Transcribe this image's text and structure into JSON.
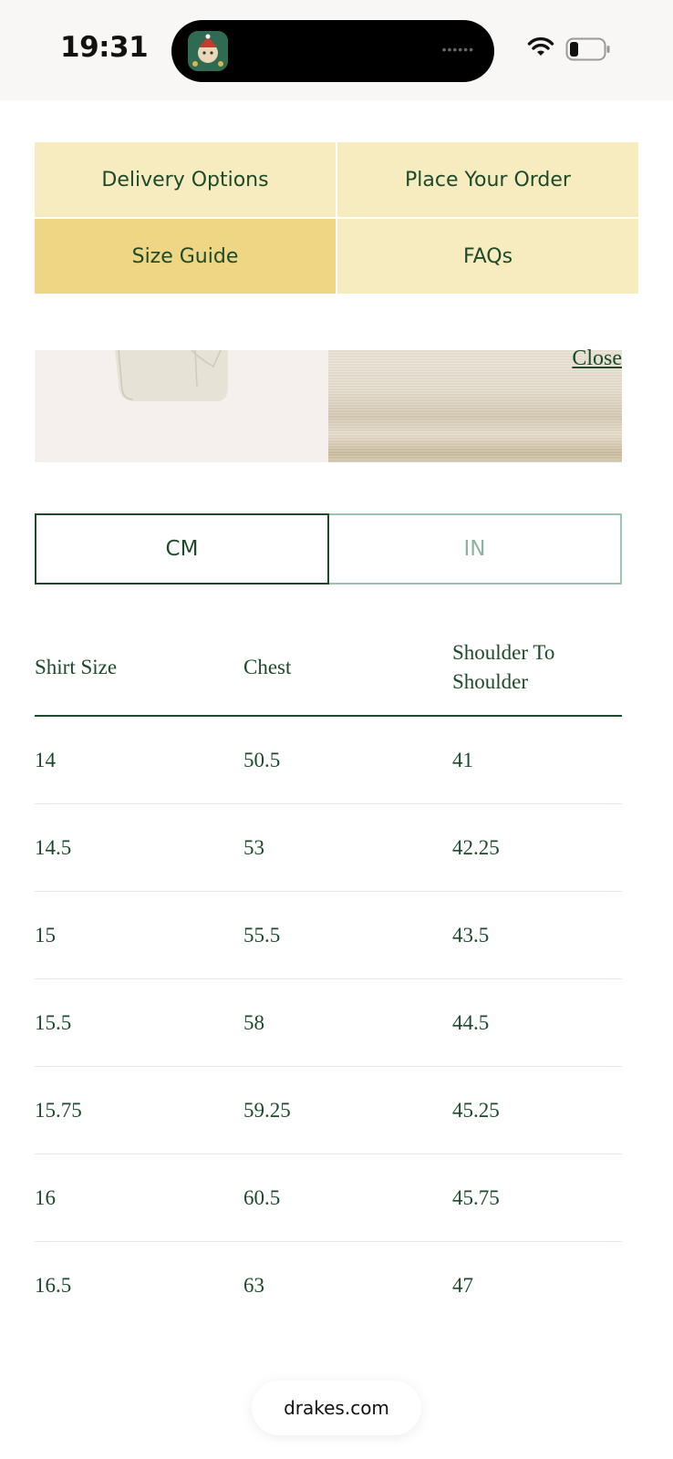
{
  "status_bar": {
    "time": "19:31"
  },
  "tabs": [
    {
      "label": "Delivery Options",
      "active": false
    },
    {
      "label": "Place Your Order",
      "active": false
    },
    {
      "label": "Size Guide",
      "active": true
    },
    {
      "label": "FAQs",
      "active": false
    }
  ],
  "gallery": {
    "close_label": "Close"
  },
  "units": {
    "cm_label": "CM",
    "in_label": "IN",
    "selected": "CM"
  },
  "size_table": {
    "headers": [
      "Shirt Size",
      "Chest",
      "Shoulder To Shoulder"
    ],
    "rows": [
      [
        "14",
        "50.5",
        "41"
      ],
      [
        "14.5",
        "53",
        "42.25"
      ],
      [
        "15",
        "55.5",
        "43.5"
      ],
      [
        "15.5",
        "58",
        "44.5"
      ],
      [
        "15.75",
        "59.25",
        "45.25"
      ],
      [
        "16",
        "60.5",
        "45.75"
      ],
      [
        "16.5",
        "63",
        "47"
      ]
    ]
  },
  "browser": {
    "url": "drakes.com"
  },
  "colors": {
    "brand_green": "#1d4a2a",
    "tab_background": "#f6ecc0",
    "tab_active": "#efd685"
  }
}
